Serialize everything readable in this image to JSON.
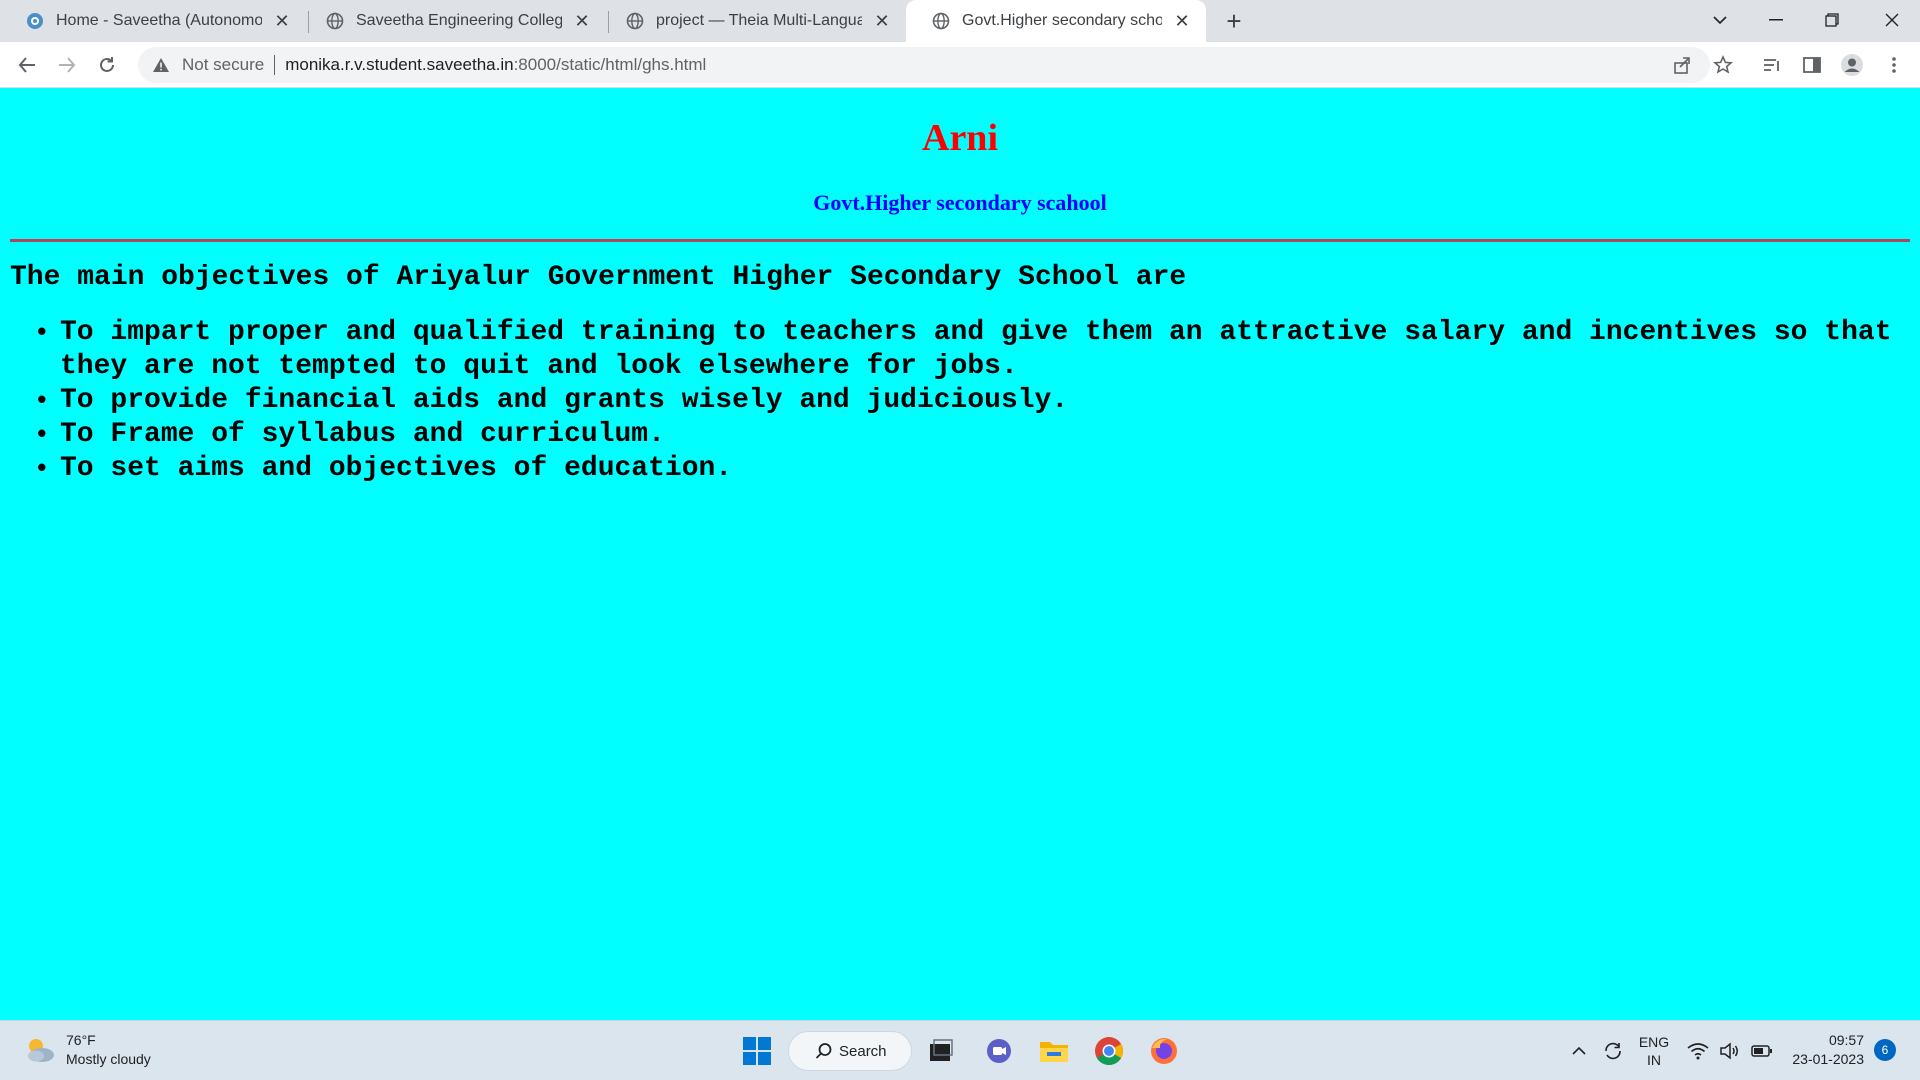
{
  "browser": {
    "tabs": [
      {
        "title": "Home - Saveetha (Autonomous)",
        "favicon": "saveetha-icon",
        "active": false
      },
      {
        "title": "Saveetha Engineering College",
        "favicon": "globe-icon",
        "active": false
      },
      {
        "title": "project — Theia Multi-Language",
        "favicon": "globe-icon",
        "active": false
      },
      {
        "title": "Govt.Higher secondary school",
        "favicon": "globe-icon",
        "active": true
      }
    ],
    "new_tab_label": "+",
    "address": {
      "security_label": "Not secure",
      "host": "monika.r.v.student.saveetha.in",
      "path": ":8000/static/html/ghs.html"
    }
  },
  "page": {
    "title": "Arni",
    "subtitle": "Govt.Higher secondary scahool",
    "intro": "The main objectives of Ariyalur Government Higher Secondary School are",
    "objectives": [
      "To impart proper and qualified training to teachers and give them an attractive salary and incentives so that they are not tempted to quit and look elsewhere for jobs.",
      "To provide financial aids and grants wisely and judiciously.",
      "To Frame of syllabus and curriculum.",
      "To set aims and objectives of education."
    ],
    "background_color": "#00ffff",
    "title_color": "#ff0000",
    "subtitle_color": "#0000ff"
  },
  "taskbar": {
    "weather": {
      "temperature": "76°F",
      "condition": "Mostly cloudy"
    },
    "search_label": "Search",
    "language": {
      "lang": "ENG",
      "region": "IN"
    },
    "clock": {
      "time": "09:57",
      "date": "23-01-2023"
    },
    "notification_count": "6"
  }
}
